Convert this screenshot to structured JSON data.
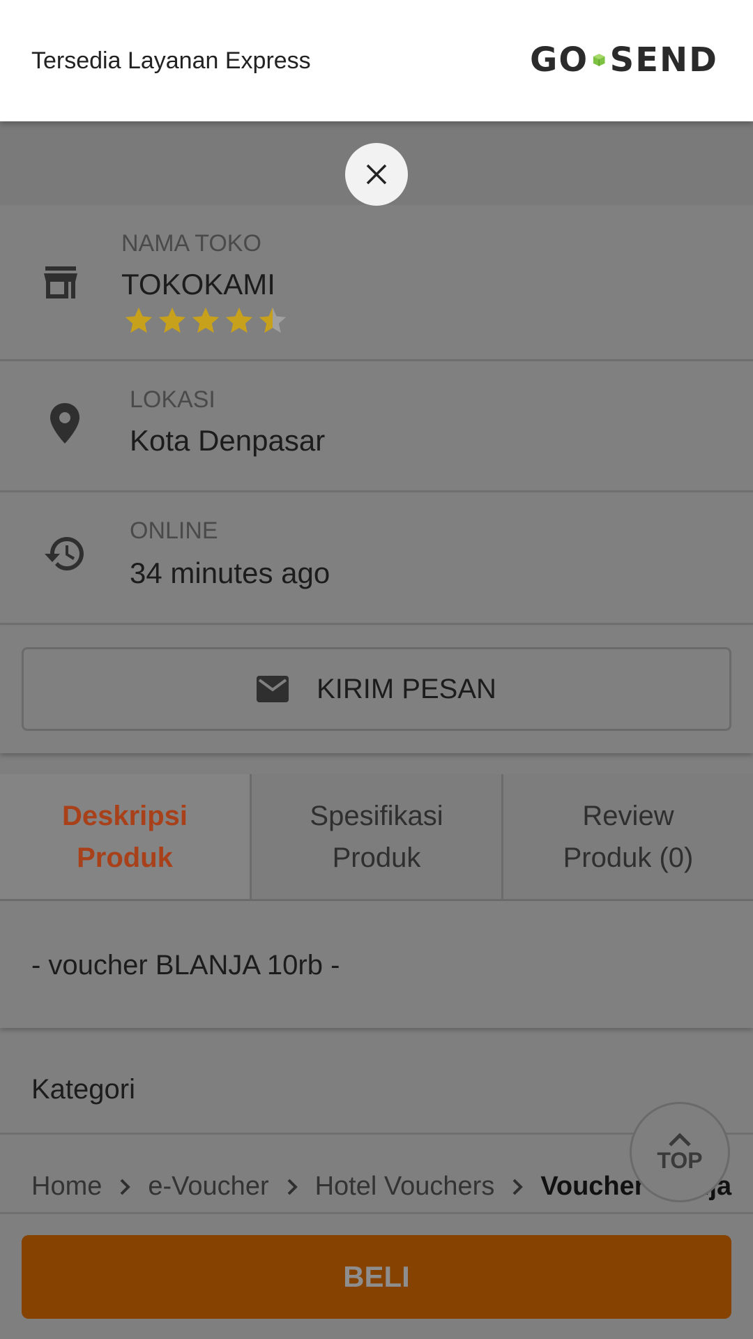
{
  "header": {
    "text": "Tersedia Layanan Express",
    "logo_left": "GO",
    "logo_right": "SEND",
    "logo_color": "#7dc242"
  },
  "store": {
    "name_label": "NAMA TOKO",
    "name": "TOKOKAMI",
    "rating": 4.5,
    "rating_max": 5,
    "star_color": "#c8a11c"
  },
  "location": {
    "label": "LOKASI",
    "value": "Kota Denpasar"
  },
  "online": {
    "label": "ONLINE",
    "value": "34 minutes ago"
  },
  "message_button": {
    "label": "KIRIM PESAN"
  },
  "tabs": [
    {
      "line1": "Deskripsi",
      "line2": "Produk",
      "active": true
    },
    {
      "line1": "Spesifikasi",
      "line2": "Produk",
      "active": false
    },
    {
      "line1": "Review",
      "line2": "Produk (0)",
      "active": false
    }
  ],
  "description": {
    "text": "- voucher BLANJA 10rb -"
  },
  "kategori": {
    "title": "Kategori",
    "breadcrumb": [
      "Home",
      "e-Voucher",
      "Hotel Vouchers",
      "Voucher Blanja"
    ]
  },
  "top_button": {
    "label": "TOP"
  },
  "buy_button": {
    "label": "BELI",
    "color": "#854200"
  },
  "icons": {
    "close": "close-icon",
    "store": "store-icon",
    "location": "location-pin-icon",
    "history": "history-icon",
    "mail": "mail-icon",
    "chevron": "chevron-right-icon",
    "up": "chevron-up-icon"
  }
}
